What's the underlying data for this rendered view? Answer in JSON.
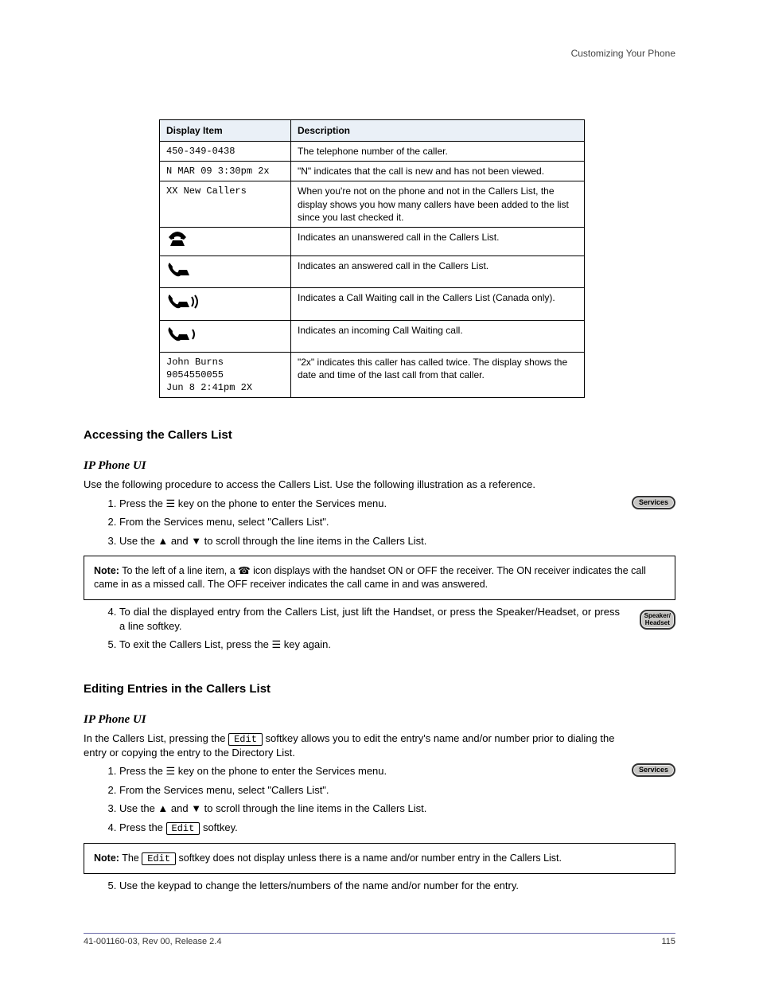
{
  "header_top": "Customizing Your Phone",
  "table": {
    "headers": [
      "Display Item",
      "Description"
    ],
    "rows": [
      {
        "display": [
          "450-349-0438"
        ],
        "desc": "The telephone number of the caller.",
        "icon": null
      },
      {
        "display": [
          "N MAR 09 3:30pm 2x"
        ],
        "desc": "\"N\" indicates that the call is new and has not been viewed.",
        "icon": null
      },
      {
        "display": [
          "XX New Callers"
        ],
        "desc": "When you're not on the phone and not in the Callers List, the display shows you how many callers have been added to the list since you last checked it.",
        "icon": null
      },
      {
        "display": [],
        "desc": "Indicates an unanswered call in the Callers List.",
        "icon": "phone-onhook"
      },
      {
        "display": [],
        "desc": "Indicates an answered call in the Callers List.",
        "icon": "phone-offhook"
      },
      {
        "display": [],
        "desc": "Indicates a Call Waiting call in the Callers List (Canada only).",
        "icon": "phone-waiting2"
      },
      {
        "display": [],
        "desc": "Indicates an incoming Call Waiting call.",
        "icon": "phone-waiting1"
      },
      {
        "display": [
          "John Burns",
          "9054550055",
          "Jun 8 2:41pm 2X"
        ],
        "desc": "\"2x\" indicates this caller has called twice. The display shows the date and time of the last call from that caller.",
        "icon": null
      }
    ]
  },
  "section_title": "Accessing the Callers List",
  "sub_title_a": "IP Phone UI",
  "intro_a": "Use the following procedure to access the Callers List. Use the following illustration as a reference.",
  "steps_a": [
    "Press the ☰ key on the phone to enter the Services menu.",
    "From the Services menu, select \"Callers List\".",
    "Use the ▲ and ▼ to scroll through the line items in the Callers List.",
    "To dial the displayed entry from the Callers List, just lift the Handset, or press the Speaker/Headset, or press a line softkey.",
    "To exit the Callers List, press the ☰ key again."
  ],
  "note_a": "To the left of a line item, a ☎ icon displays with the handset ON or OFF the receiver. The ON receiver indicates the call came in as a missed call. The OFF receiver indicates the call came in and was answered.",
  "section_title_b": "Editing Entries in the Callers List",
  "sub_title_b": "IP Phone UI",
  "intro_b": "In the Callers List, pressing the Edit softkey allows you to edit the entry's name and/or number prior to dialing the entry or copying the entry to the Directory List.",
  "steps_b": [
    "Press the ☰ key on the phone to enter the Services menu.",
    "From the Services menu, select \"Callers List\".",
    "Use the ▲ and ▼ to scroll through the line items in the Callers List.",
    "Press the Edit softkey.",
    "Use the keypad to change the letters/numbers of the name and/or number for the entry."
  ],
  "note_b": "The Edit softkey does not display unless there is a name and/or number entry in the Callers List.",
  "edit_softkey": "Edit",
  "key_services": "Services",
  "key_speaker": "Speaker/\nHeadset",
  "footer_left": "41-001160-03, Rev 00, Release 2.4",
  "footer_right": "115",
  "note_label": "Note:"
}
